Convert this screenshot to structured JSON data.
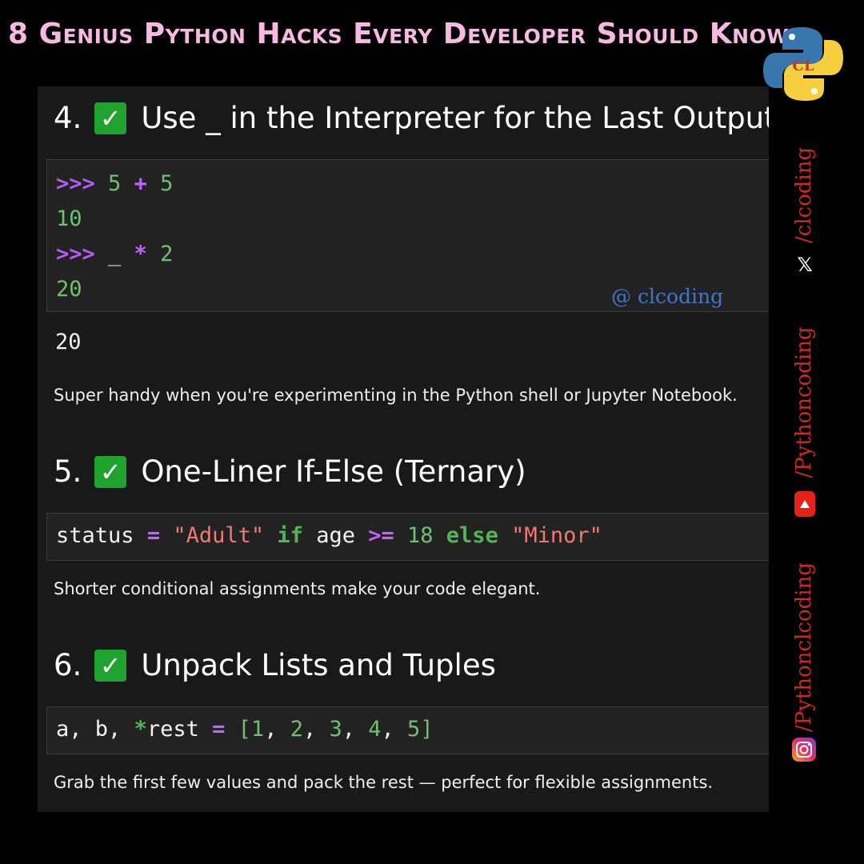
{
  "banner": {
    "title": "8 Genius Python Hacks Every Developer Should Know"
  },
  "logo": {
    "letters": "CL"
  },
  "sections": [
    {
      "number": "4.",
      "title": "Use _ in the Interpreter for the Last Output",
      "code": {
        "line1": {
          "prompt": ">>>",
          "a": "5",
          "op": "+",
          "b": "5"
        },
        "line2": "10",
        "line3": {
          "prompt": ">>>",
          "a": "_",
          "op": "*",
          "b": "2"
        },
        "line4": "20"
      },
      "watermark": "@ clcoding",
      "output": "20",
      "description": "Super handy when you're experimenting in the Python shell or Jupyter Notebook."
    },
    {
      "number": "5.",
      "title": "One-Liner If-Else (Ternary)",
      "code": {
        "var": "status",
        "eq": "=",
        "s1": "\"Adult\"",
        "if": "if",
        "age": "age",
        "ge": ">=",
        "n": "18",
        "else": "else",
        "s2": "\"Minor\""
      },
      "description": "Shorter conditional assignments make your code elegant."
    },
    {
      "number": "6.",
      "title": "Unpack Lists and Tuples",
      "code": {
        "a": "a,",
        "b": "b,",
        "star": "*",
        "rest": "rest",
        "eq": "=",
        "open": "[",
        "v1": "1",
        "v2": "2",
        "v3": "3",
        "v4": "4",
        "v5": "5",
        "close": "]"
      },
      "description": "Grab the first few values and pack the rest — perfect for flexible assignments."
    }
  ],
  "social": {
    "twitter": "/clcoding",
    "youtube": "/Pythoncoding",
    "instagram": "/Pythonclcoding"
  },
  "colors": {
    "title_pink": "#f7b8e2",
    "social_red": "#cf2b1c",
    "check_green": "#1fa22e",
    "watermark_blue": "#3d77c9"
  }
}
